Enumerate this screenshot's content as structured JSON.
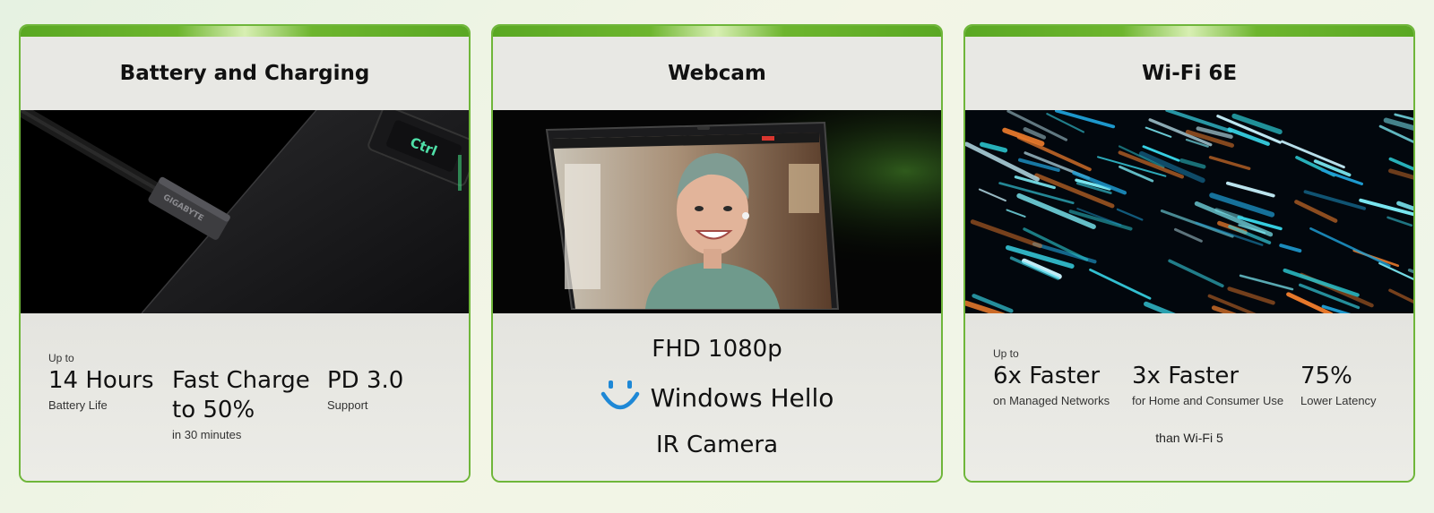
{
  "cards": {
    "battery": {
      "title": "Battery and Charging",
      "cable_brand": "GIGABYTE",
      "key_label": "Ctrl",
      "stats": [
        {
          "pre": "Up to",
          "big": "14 Hours",
          "sub": "Battery Life"
        },
        {
          "big_line1": "Fast Charge",
          "big_line2": "to 50%",
          "sub": "in 30 minutes"
        },
        {
          "big": "PD 3.0",
          "sub": "Support"
        }
      ]
    },
    "webcam": {
      "title": "Webcam",
      "line1": "FHD 1080p",
      "line2": "Windows Hello",
      "line3": "IR Camera",
      "hello_icon": "smiley-face-icon",
      "accent": "#1e88d6"
    },
    "wifi": {
      "title": "Wi-Fi 6E",
      "stats": [
        {
          "pre": "Up to",
          "big": "6x Faster",
          "sub": "on Managed Networks"
        },
        {
          "big": "3x Faster",
          "sub": "for Home and Consumer Use"
        },
        {
          "big": "75%",
          "sub": "Lower Latency"
        }
      ],
      "footnote": "than Wi-Fi 5"
    }
  },
  "colors": {
    "border": "#6fb63a",
    "topbar": "#5aa823"
  }
}
